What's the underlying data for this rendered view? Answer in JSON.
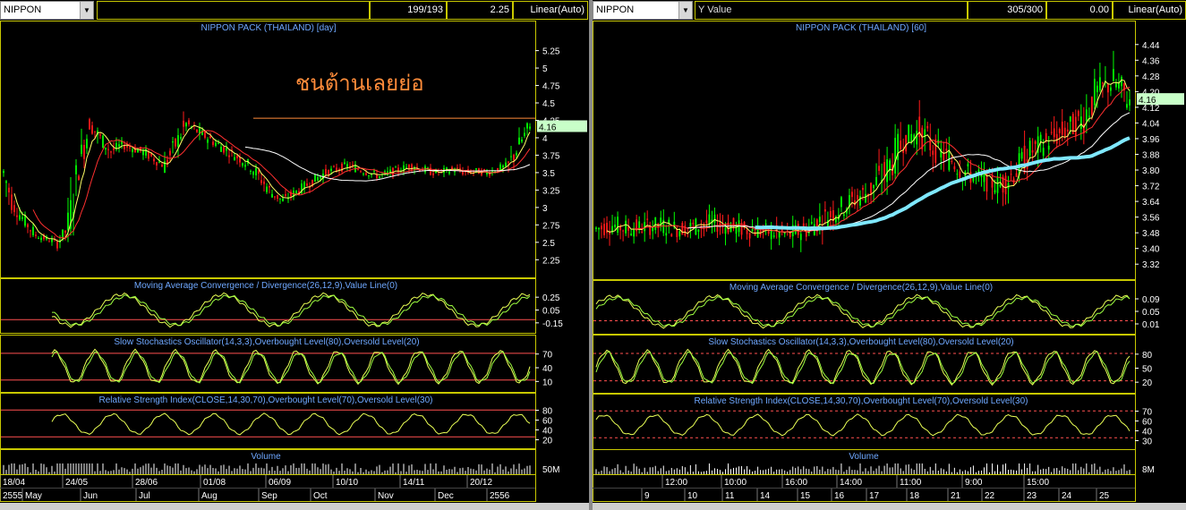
{
  "colors": {
    "frame": "#c8c800",
    "bull": "#00ff00",
    "bear": "#ff1a1a",
    "ma_short": "#ffff66",
    "ma_mid": "#ff3030",
    "ma_long": "#ffffff",
    "ma_longest": "#7fe8ff",
    "title": "#6fa8ff",
    "axis": "#ffffff",
    "level": "#ff5050",
    "price_tag": "#c8ffc8"
  },
  "left": {
    "symbol": "NIPPON",
    "field2": "",
    "count": "199/193",
    "value": "2.25",
    "scale": "Linear(Auto)",
    "price_title": "NIPPON PACK (THAILAND) [day]",
    "annotation": "ชนต้านเลยย่อ",
    "last_price": "4.16",
    "price_ticks": [
      "5.25",
      "5",
      "4.75",
      "4.5",
      "4.25",
      "4",
      "3.75",
      "3.5",
      "3.25",
      "3",
      "2.75",
      "2.5",
      "2.25"
    ],
    "macd_title": "Moving Average Convergence / Divergence(26,12,9),Value Line(0)",
    "macd_ticks": [
      "0.25",
      "0.05",
      "-0.15"
    ],
    "stoch_title": "Slow Stochastics Oscillator(14,3,3),Overbought Level(80),Oversold Level(20)",
    "stoch_ticks": [
      "70",
      "40",
      "10"
    ],
    "rsi_title": "Relative Strength Index(CLOSE,14,30,70),Overbought Level(70),Oversold Level(30)",
    "rsi_ticks": [
      "80",
      "60",
      "40",
      "20"
    ],
    "volume_title": "Volume",
    "volume_tick": "50M",
    "date_labels": [
      "18/04",
      "24/05",
      "28/06",
      "01/08",
      "06/09",
      "10/10",
      "14/11",
      "20/12"
    ],
    "month_labels": [
      "2555",
      "May",
      "Jun",
      "Jul",
      "Aug",
      "Sep",
      "Oct",
      "Nov",
      "Dec",
      "2556"
    ]
  },
  "right": {
    "symbol": "NIPPON",
    "field2": "Y Value",
    "count": "305/300",
    "value": "0.00",
    "scale": "Linear(Auto)",
    "price_title": "NIPPON PACK (THAILAND) [60]",
    "last_price": "4.16",
    "price_ticks": [
      "4.44",
      "4.36",
      "4.28",
      "4.20",
      "4.12",
      "4.04",
      "3.96",
      "3.88",
      "3.80",
      "3.72",
      "3.64",
      "3.56",
      "3.48",
      "3.40",
      "3.32"
    ],
    "macd_title": "Moving Average Convergence / Divergence(26,12,9),Value Line(0)",
    "macd_ticks": [
      "0.09",
      "0.05",
      "0.01"
    ],
    "stoch_title": "Slow Stochastics Oscillator(14,3,3),Overbought Level(80),Oversold Level(20)",
    "stoch_ticks": [
      "80",
      "50",
      "20"
    ],
    "rsi_title": "Relative Strength Index(CLOSE,14,30,70),Overbought Level(70),Oversold Level(30)",
    "rsi_ticks": [
      "70",
      "60",
      "40",
      "30"
    ],
    "volume_title": "Volume",
    "volume_tick": "8M",
    "time_labels": [
      "12:00",
      "10:00",
      "16:00",
      "14:00",
      "11:00",
      "9:00",
      "15:00"
    ],
    "day_labels": [
      "9",
      "10",
      "11",
      "14",
      "15",
      "16",
      "17",
      "18",
      "21",
      "22",
      "23",
      "24",
      "25"
    ]
  },
  "chart_data": [
    {
      "type": "candlestick",
      "title": "NIPPON PACK (THAILAND) [day]",
      "ylim": [
        2.1,
        5.45
      ],
      "close": [
        3.5,
        3.0,
        2.8,
        2.6,
        2.55,
        2.5,
        2.7,
        3.6,
        4.2,
        4.0,
        3.8,
        3.9,
        3.85,
        3.8,
        3.7,
        3.6,
        3.9,
        4.2,
        4.1,
        4.0,
        3.9,
        3.8,
        3.7,
        3.6,
        3.4,
        3.2,
        3.1,
        3.2,
        3.3,
        3.4,
        3.5,
        3.55,
        3.6,
        3.55,
        3.5,
        3.45,
        3.5,
        3.55,
        3.6,
        3.55,
        3.5,
        3.52,
        3.55,
        3.5,
        3.52,
        3.5,
        3.55,
        3.6,
        3.9,
        4.16
      ],
      "overlays": [
        {
          "name": "MA short",
          "color": "ma_short"
        },
        {
          "name": "MA mid",
          "color": "ma_mid"
        },
        {
          "name": "MA long",
          "color": "ma_long"
        }
      ],
      "resistance": 4.28
    },
    {
      "type": "candlestick",
      "title": "NIPPON PACK (THAILAND) [60]",
      "ylim": [
        3.28,
        4.48
      ],
      "close": [
        3.5,
        3.52,
        3.5,
        3.51,
        3.52,
        3.5,
        3.51,
        3.53,
        3.52,
        3.5,
        3.49,
        3.48,
        3.47,
        3.5,
        3.55,
        3.6,
        3.65,
        3.7,
        3.8,
        3.95,
        4.0,
        3.9,
        3.85,
        3.78,
        3.75,
        3.72,
        3.8,
        3.9,
        3.95,
        4.0,
        4.05,
        4.2,
        4.25,
        4.16
      ]
    }
  ]
}
